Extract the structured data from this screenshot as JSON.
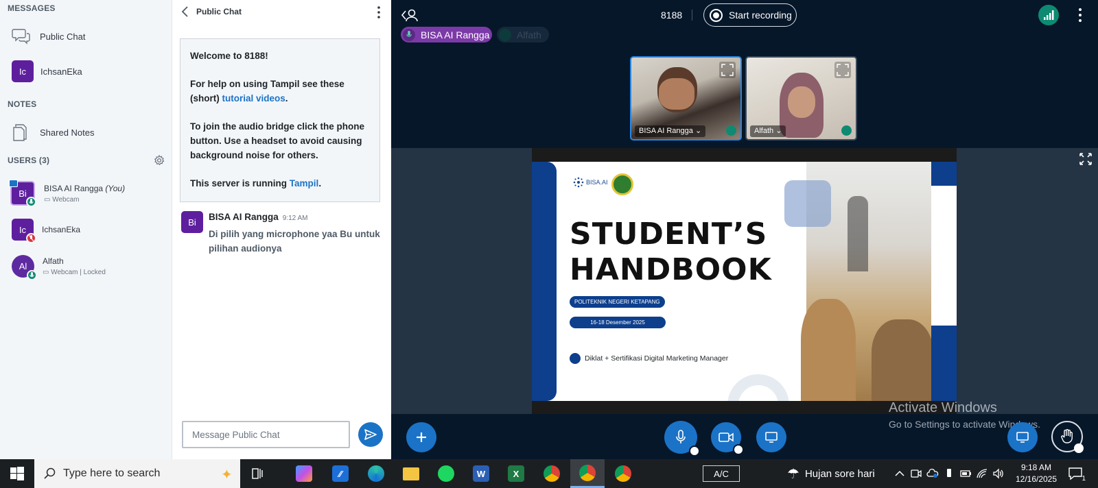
{
  "sidebar": {
    "messages_title": "MESSAGES",
    "public_chat_label": "Public Chat",
    "private_chat": {
      "initials": "Ic",
      "name": "IchsanEka"
    },
    "notes_title": "NOTES",
    "shared_notes_label": "Shared Notes",
    "users_title": "USERS (3)",
    "users": [
      {
        "initials": "Bi",
        "name": "BISA AI Rangga",
        "you": "(You)",
        "sub": "Webcam",
        "status": "mic-on"
      },
      {
        "initials": "Ic",
        "name": "IchsanEka",
        "you": "",
        "sub": "",
        "status": "mic-muted"
      },
      {
        "initials": "Al",
        "name": "Alfath",
        "you": "",
        "sub": "Webcam | Locked",
        "status": "mic-on"
      }
    ]
  },
  "chat": {
    "title": "Public Chat",
    "welcome": {
      "line1": "Welcome to 8188!",
      "help_prefix": "For help on using Tampil see these (short) ",
      "help_link": "tutorial videos",
      "help_suffix": ".",
      "audio": "To join the audio bridge click the phone button. Use a headset to avoid causing background noise for others.",
      "server_prefix": "This server is running ",
      "server_link": "Tampil",
      "server_suffix": "."
    },
    "message": {
      "initials": "Bi",
      "sender": "BISA AI Rangga",
      "time": "9:12 AM",
      "text": "Di pilih yang microphone yaa Bu untuk pilihan audionya"
    },
    "input_placeholder": "Message Public Chat"
  },
  "meeting": {
    "name": "8188",
    "record_label": "Start recording",
    "talkers": [
      {
        "name": "BISA AI Rangga",
        "active": true
      },
      {
        "name": "Alfath",
        "active": false
      }
    ],
    "webcams": [
      {
        "name": "BISA AI Rangga"
      },
      {
        "name": "Alfath"
      }
    ],
    "slide": {
      "logo_text": "BISA.AI",
      "title_line1": "STUDENT’S",
      "title_line2": "HANDBOOK",
      "pill1": "POLITEKNIK NEGERI KETAPANG",
      "pill2": "16-18 Desember 2025",
      "bullet": "Diklat + Sertifikasi Digital Marketing Manager"
    },
    "activate_title": "Activate Windows",
    "activate_sub": "Go to Settings to activate Windows."
  },
  "taskbar": {
    "search_placeholder": "Type here to search",
    "ac_label": "A/C",
    "weather": "Hujan sore hari",
    "time": "9:18 AM",
    "date": "12/16/2025",
    "notif_count": "1"
  },
  "colors": {
    "accent": "#1b73c7",
    "avatar_purple": "#5e1f9e",
    "talker_active": "#7c3aa8",
    "meeting_bg": "#06172a",
    "mic_green": "#0e8a72",
    "muted_red": "#d9363e"
  }
}
